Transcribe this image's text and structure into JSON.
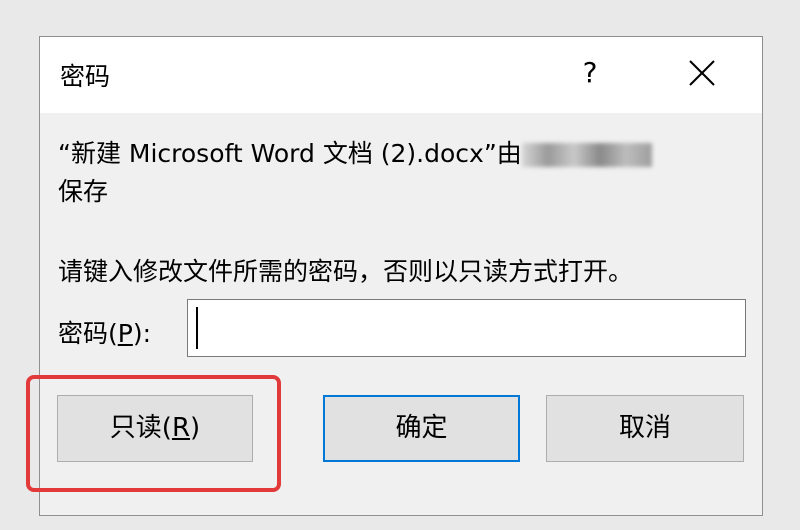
{
  "dialog": {
    "title": "密码",
    "message_line1": "“新建 Microsoft Word 文档 (2).docx”由",
    "message_line2": "保存",
    "instruction": "请键入修改文件所需的密码，否则以只读方式打开。",
    "password_label": "密码(",
    "password_label_key": "P",
    "password_label_end": "):",
    "password_value": "",
    "buttons": {
      "readonly_label": "只读(",
      "readonly_key": "R",
      "readonly_end": ")",
      "ok_label": "确定",
      "cancel_label": "取消"
    },
    "help_glyph": "?"
  },
  "colors": {
    "highlight": "#e23a3a",
    "default_button_border": "#0078d7"
  },
  "icons": [
    "help-icon",
    "close-icon"
  ]
}
